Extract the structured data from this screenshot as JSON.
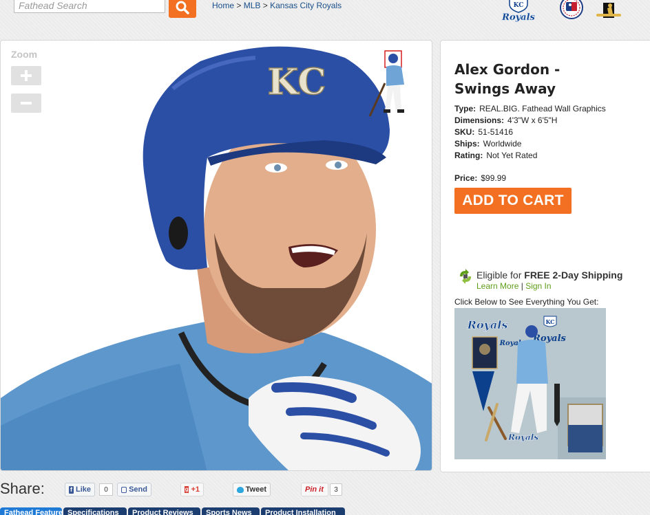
{
  "search": {
    "placeholder": "Fathead Search",
    "value": ""
  },
  "breadcrumb": {
    "items": [
      "Home",
      "MLB",
      "Kansas City Royals"
    ],
    "separator": ">"
  },
  "top_logos": [
    "Royals",
    "MLB",
    "Players"
  ],
  "zoom": {
    "label": "Zoom",
    "in_icon": "plus-icon",
    "out_icon": "minus-icon"
  },
  "product": {
    "title": "Alex Gordon - Swings Away",
    "specs": [
      {
        "label": "Type:",
        "value": "REAL.BIG. Fathead Wall Graphics"
      },
      {
        "label": "Dimensions:",
        "value": "4'3\"W x 6'5\"H"
      },
      {
        "label": "SKU:",
        "value": "51-51416"
      },
      {
        "label": "Ships:",
        "value": "Worldwide"
      },
      {
        "label": "Rating:",
        "value": "Not Yet Rated"
      }
    ],
    "price_label": "Price:",
    "price": "$99.99",
    "add_to_cart": "ADD TO CART"
  },
  "shipping": {
    "eligible_text": "Eligible for ",
    "free_text": "FREE 2-Day Shipping",
    "learn_more": "Learn More",
    "sign_in": "Sign In",
    "divider": "|"
  },
  "kit": {
    "caption": "Click Below to See Everything You Get:"
  },
  "share": {
    "label": "Share:",
    "like": "Like",
    "like_count": "0",
    "send": "Send",
    "gplus": "+1",
    "tweet": "Tweet",
    "pinit": "Pin it",
    "pin_count": "3"
  },
  "tabs": [
    "Fathead Features",
    "Specifications",
    "Product Reviews",
    "Sports News",
    "Product Installation"
  ],
  "colors": {
    "accent_orange": "#f36f21",
    "tab_navy": "#1b3d70",
    "tab_active": "#1f7ad6",
    "link_green": "#5e9e1a",
    "link_blue": "#1a4e8a"
  }
}
